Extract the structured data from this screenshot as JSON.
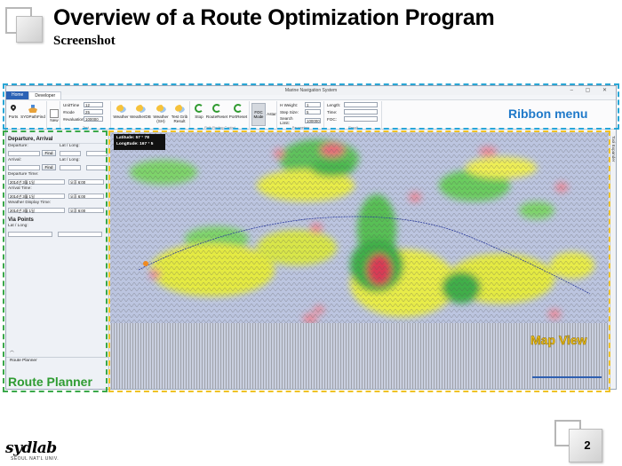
{
  "slide": {
    "title": "Overview of a Route Optimization Program",
    "subtitle": "Screenshot",
    "page_number": "2",
    "logo_text": "sydlab",
    "logo_subtext": "SEOUL NAT'L UNIV."
  },
  "app": {
    "window_title": "Marine Navigation System",
    "tabs": [
      "Home",
      "Developer"
    ],
    "ribbon": {
      "buttons": {
        "ports": "Ports",
        "sydpathfind": "SYDPathFind",
        "new": "New",
        "weather": "Weather",
        "weather_db": "WeatherDB",
        "weather_sh": "Weather (SH)",
        "test_grib": "Test Grib Result",
        "stop": "Stop",
        "route_reset": "RouteReset",
        "port_reset": "PortReset",
        "foc_mode": "FOC Mode",
        "astar": "Astar"
      },
      "fields": [
        {
          "label": "UnitTime",
          "value": "12"
        },
        {
          "label": "#node",
          "value": "25"
        },
        {
          "label": "#evaluation",
          "value": "100000"
        }
      ],
      "weights": [
        {
          "label": "H Weight:",
          "value": "1"
        },
        {
          "label": "Step Size:",
          "value": "5"
        },
        {
          "label": "Search Limit:",
          "value": "100000"
        }
      ],
      "results": [
        {
          "label": "Length:",
          "value": ""
        },
        {
          "label": "Time:",
          "value": ""
        },
        {
          "label": "FOC:",
          "value": ""
        }
      ],
      "group_labels": [
        "Test",
        "Weather",
        "Path Finding Control",
        "Parameters",
        "Result"
      ]
    },
    "left_panel": {
      "departure_arrival_header": "Departure, Arrival",
      "departure_label": "Departure:",
      "arrival_label": "Arrival:",
      "latlong_label": "Lat / Long:",
      "find_label": "Find",
      "departure_time_label": "Departure Time:",
      "arrival_time_label": "Arrival Time:",
      "weather_display_label": "Weather Display Time:",
      "date_value": "2014년 3월 1일",
      "time_value": "오후 6:00",
      "via_points_header": "Via Points",
      "via_latlong_label": "Lat / Long:",
      "route_planner_tab": "Route Planner"
    },
    "map": {
      "latitude_label": "Latitude:",
      "latitude_value": "57 °  78",
      "longitude_label": "LongItude:",
      "longitude_value": "167 °  5",
      "side_label": "Tool Expander"
    }
  },
  "annotations": {
    "ribbon_menu": "Ribbon menu",
    "route_planner": "Route Planner",
    "map_view": "Map View",
    "colors": {
      "ribbon": "#1f79c9",
      "route": "#2f9c32",
      "map": "#f3c318"
    }
  }
}
